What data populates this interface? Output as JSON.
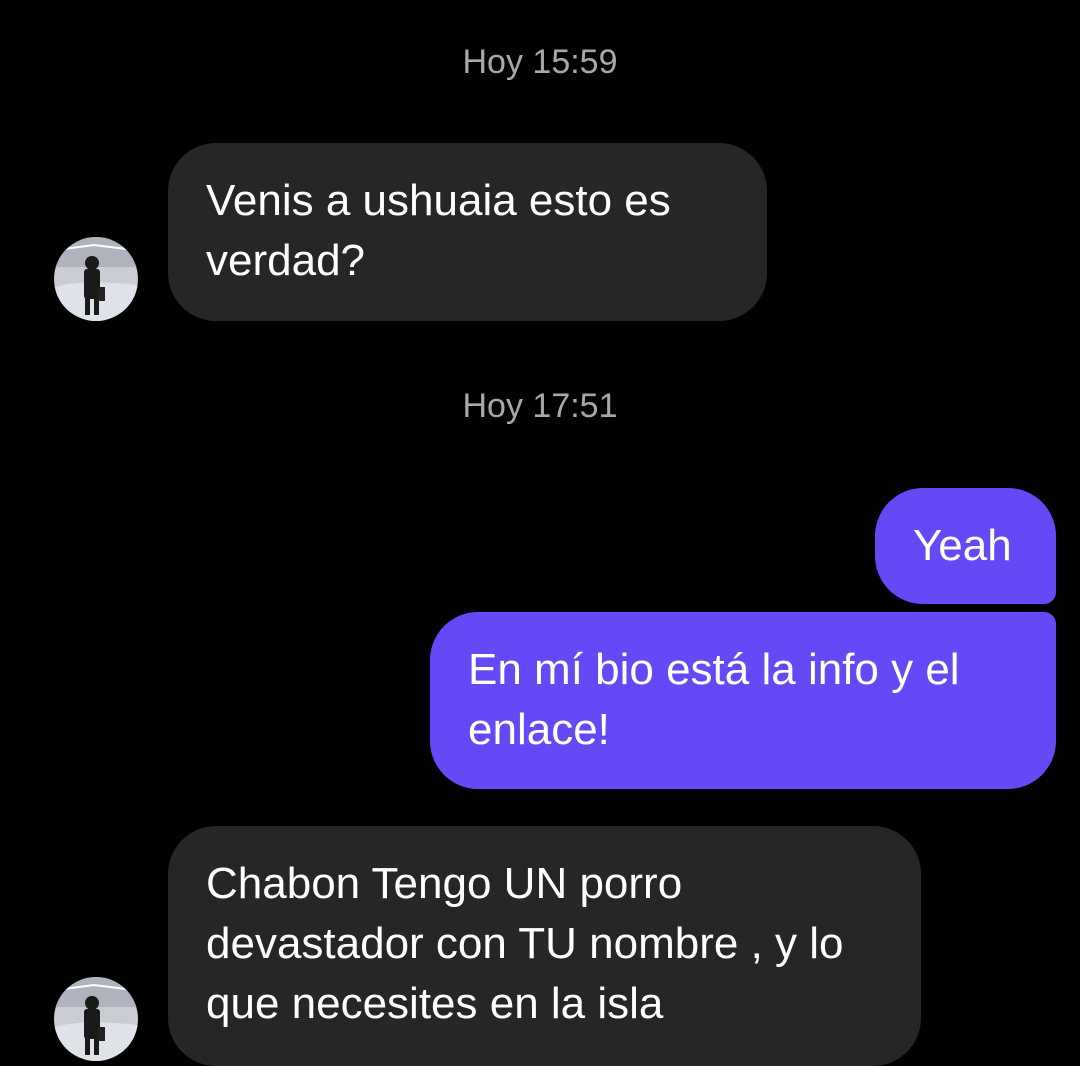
{
  "conversation": {
    "messages": [
      {
        "type": "timestamp",
        "text": "Hoy 15:59"
      },
      {
        "type": "incoming",
        "text": "Venis a ushuaia esto es verdad?",
        "avatar": "user-avatar-icon"
      },
      {
        "type": "timestamp",
        "text": "Hoy 17:51"
      },
      {
        "type": "outgoing",
        "text": "Yeah"
      },
      {
        "type": "outgoing",
        "text": "En mí bio está la info y el enlace!"
      },
      {
        "type": "incoming",
        "text": "Chabon Tengo UN porro devastador con TU nombre , y lo que necesites en la isla",
        "avatar": "user-avatar-icon"
      }
    ]
  },
  "colors": {
    "background": "#000000",
    "incoming_bubble": "#262626",
    "outgoing_bubble": "#6549f7",
    "timestamp_text": "#a8a8a8",
    "message_text": "#ffffff"
  }
}
